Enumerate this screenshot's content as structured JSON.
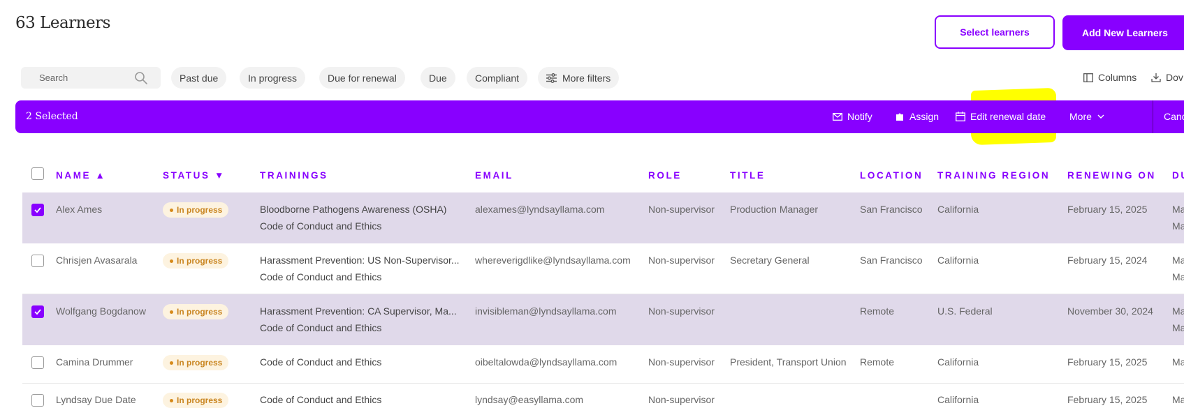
{
  "header": {
    "title": "63 Learners",
    "select_learners": "Select learners",
    "add_new": "Add New Learners"
  },
  "search": {
    "placeholder": "Search"
  },
  "filters": [
    "Past due",
    "In progress",
    "Due for renewal",
    "Due",
    "Compliant"
  ],
  "more_filters": "More filters",
  "tools": {
    "columns": "Columns",
    "download": "Dov"
  },
  "selection_bar": {
    "count": "2 Selected",
    "notify": "Notify",
    "assign": "Assign",
    "edit_renewal": "Edit renewal date",
    "more": "More",
    "cancel": "Canc"
  },
  "table": {
    "headers": {
      "name": "NAME ▲",
      "status": "STATUS ▼",
      "trainings": "TRAININGS",
      "email": "EMAIL",
      "role": "ROLE",
      "title": "TITLE",
      "location": "LOCATION",
      "region": "TRAINING REGION",
      "renewing": "RENEWING ON",
      "due": "DU"
    },
    "rows": [
      {
        "selected": true,
        "name": "Alex Ames",
        "status": "In progress",
        "training1": "Bloodborne Pathogens Awareness (OSHA)",
        "training2": "Code of Conduct and Ethics",
        "email": "alexames@lyndsayllama.com",
        "role": "Non-supervisor",
        "title": "Production Manager",
        "location": "San Francisco",
        "region": "California",
        "renewing": "February 15, 2025",
        "due1": "Ma",
        "due2": "Ma"
      },
      {
        "selected": false,
        "name": "Chrisjen Avasarala",
        "status": "In progress",
        "training1": "Harassment Prevention: US Non-Supervisor...",
        "training2": "Code of Conduct and Ethics",
        "email": "whereverigdlike@lyndsayllama.com",
        "role": "Non-supervisor",
        "title": "Secretary General",
        "location": "San Francisco",
        "region": "California",
        "renewing": "February 15, 2024",
        "due1": "Ma",
        "due2": "Ma"
      },
      {
        "selected": true,
        "name": "Wolfgang Bogdanow",
        "status": "In progress",
        "training1": "Harassment Prevention: CA Supervisor, Ma...",
        "training2": "Code of Conduct and Ethics",
        "email": "invisibleman@lyndsayllama.com",
        "role": "Non-supervisor",
        "title": "",
        "location": "Remote",
        "region": "U.S. Federal",
        "renewing": "November 30, 2024",
        "due1": "Ma",
        "due2": "Ma"
      },
      {
        "selected": false,
        "name": "Camina Drummer",
        "status": "In progress",
        "training1": "Code of Conduct and Ethics",
        "training2": "",
        "email": "oibeltalowda@lyndsayllama.com",
        "role": "Non-supervisor",
        "title": "President, Transport Union",
        "location": "Remote",
        "region": "California",
        "renewing": "February 15, 2025",
        "due1": "Ma",
        "due2": ""
      },
      {
        "selected": false,
        "name": "Lyndsay Due Date",
        "status": "In progress",
        "training1": "Code of Conduct and Ethics",
        "training2": "",
        "email": "lyndsay@easyllama.com",
        "role": "Non-supervisor",
        "title": "",
        "location": "",
        "region": "California",
        "renewing": "February 15, 2025",
        "due1": "Ma",
        "due2": ""
      }
    ]
  },
  "colors": {
    "accent": "#8800ff",
    "row_selected": "#e0d9ea",
    "badge_bg": "#fdf3e0",
    "badge_text": "#c98520",
    "highlight": "#ffff00"
  }
}
